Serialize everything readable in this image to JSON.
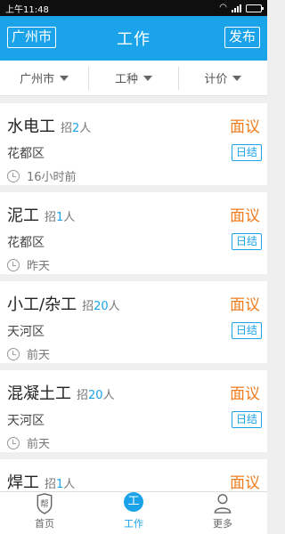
{
  "status_bar": {
    "time": "上午11:48"
  },
  "app_bar": {
    "city": "广州市",
    "title": "工作",
    "publish": "发布"
  },
  "filters": [
    {
      "label": "广州市"
    },
    {
      "label": "工种"
    },
    {
      "label": "计价"
    }
  ],
  "jobs": [
    {
      "title": "水电工",
      "recruit_prefix": "招",
      "count": "2",
      "recruit_suffix": "人",
      "area": "花都区",
      "time": "16小时前",
      "salary": "面议",
      "settlement": "日结"
    },
    {
      "title": "泥工",
      "recruit_prefix": "招",
      "count": "1",
      "recruit_suffix": "人",
      "area": "花都区",
      "time": "昨天",
      "salary": "面议",
      "settlement": "日结"
    },
    {
      "title": "小工/杂工",
      "recruit_prefix": "招",
      "count": "20",
      "recruit_suffix": "人",
      "area": "天河区",
      "time": "前天",
      "salary": "面议",
      "settlement": "日结"
    },
    {
      "title": "混凝土工",
      "recruit_prefix": "招",
      "count": "20",
      "recruit_suffix": "人",
      "area": "天河区",
      "time": "前天",
      "salary": "面议",
      "settlement": "日结"
    },
    {
      "title": "焊工",
      "recruit_prefix": "招",
      "count": "1",
      "recruit_suffix": "人",
      "area": "",
      "time": "",
      "salary": "面议",
      "settlement": ""
    }
  ],
  "bottom_nav": {
    "home": {
      "label": "首页",
      "icon_text": "帮"
    },
    "work": {
      "label": "工作",
      "icon_text": "工"
    },
    "more": {
      "label": "更多"
    }
  },
  "colors": {
    "primary": "#1aa3e8",
    "salary": "#ef7c1d"
  }
}
